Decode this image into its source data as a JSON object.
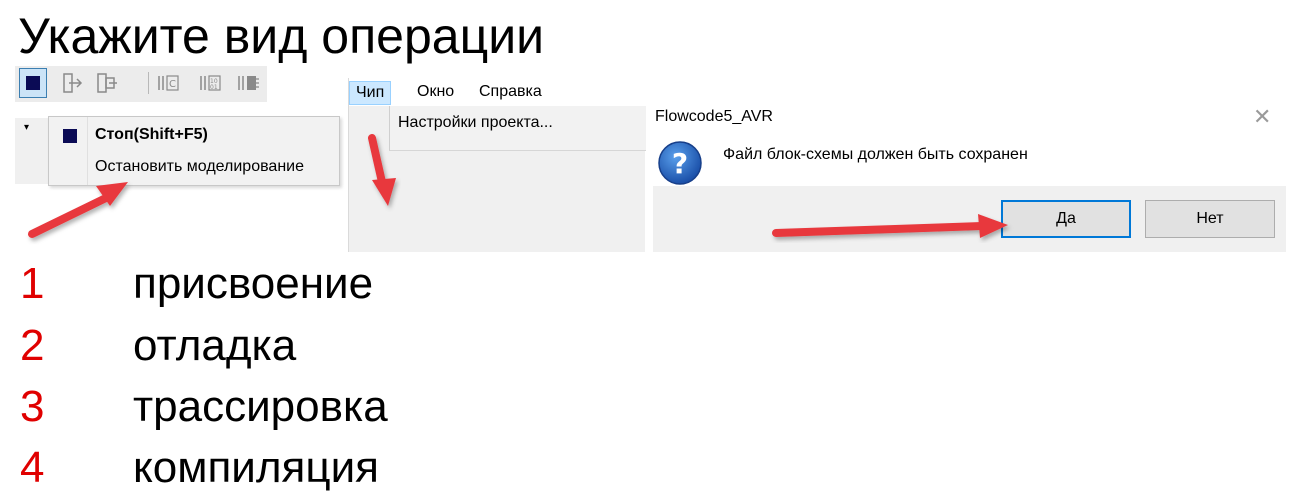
{
  "question": "Укажите вид операции",
  "toolbar": {
    "icons": [
      "stop-icon",
      "step-into-icon",
      "step-over-icon",
      "toggle-c-icon",
      "toggle-bin-icon",
      "toggle-break-icon"
    ]
  },
  "context_menu": {
    "item_stop": "Стоп(Shift+F5)",
    "item_stop_sim": "Остановить моделирование"
  },
  "menubar": {
    "chip": "Чип",
    "window": "Окно",
    "help": "Справка",
    "dropdown_item": "Настройки проекта..."
  },
  "dialog": {
    "title": "Flowcode5_AVR",
    "close": "✕",
    "message": "Файл блок-схемы должен быть сохранен",
    "yes": "Да",
    "no": "Нет"
  },
  "options": [
    {
      "number": "1",
      "label": "присвоение"
    },
    {
      "number": "2",
      "label": "отладка"
    },
    {
      "number": "3",
      "label": "трассировка"
    },
    {
      "number": "4",
      "label": "компиляция"
    }
  ],
  "colors": {
    "number": "#e00000",
    "arrow": "#e8383d",
    "stop_square": "#0b0b55",
    "menu_highlight": "#cce8ff",
    "default_button_border": "#0078d7"
  }
}
